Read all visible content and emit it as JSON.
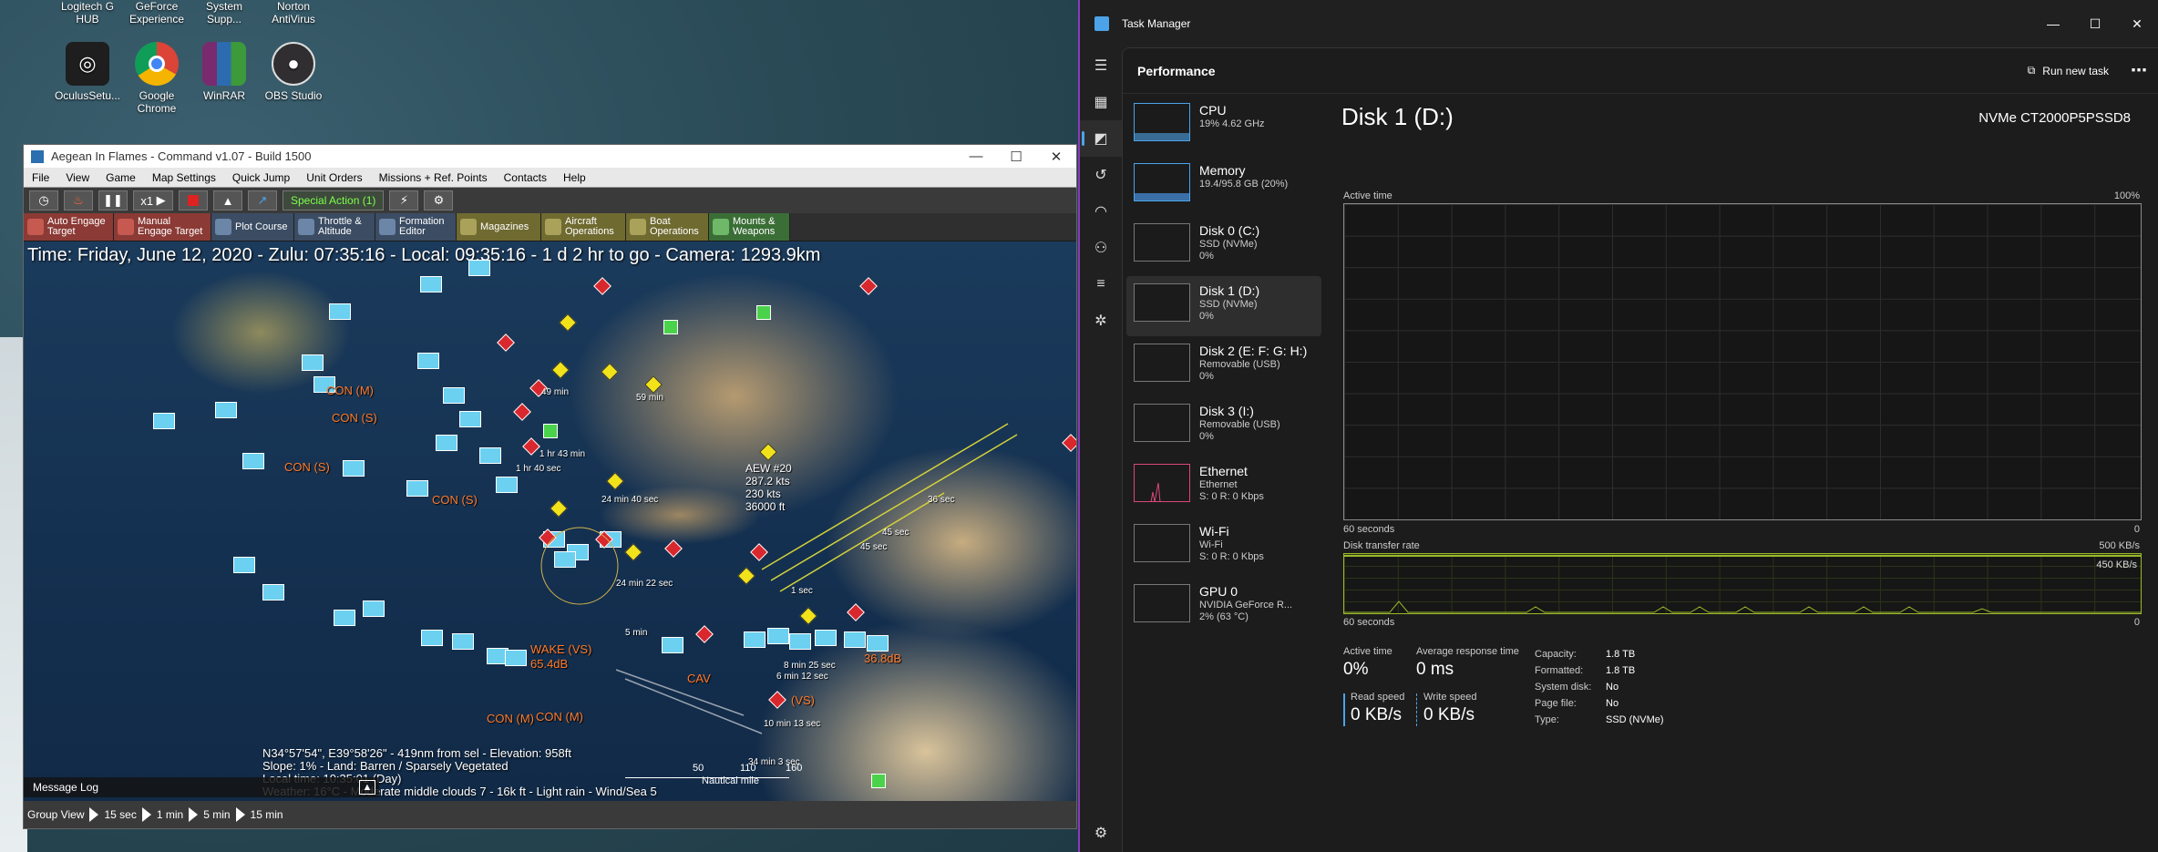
{
  "desktop": {
    "top_icons": [
      "Logitech G HUB",
      "GeForce Experience",
      "System Supp...",
      "Norton AntiVirus"
    ],
    "icons": [
      {
        "label": "OculusSetu...",
        "icon": "oculus-icon",
        "color": "#222222"
      },
      {
        "label": "Google Chrome",
        "icon": "chrome-icon",
        "color": "#db4437"
      },
      {
        "label": "WinRAR",
        "icon": "winrar-icon",
        "color": "#7a2a6e"
      },
      {
        "label": "OBS Studio",
        "icon": "obs-icon",
        "color": "#302e31"
      }
    ]
  },
  "game": {
    "title": "Aegean In Flames - Command v1.07 - Build 1500",
    "menu": [
      "File",
      "View",
      "Game",
      "Map Settings",
      "Quick Jump",
      "Unit Orders",
      "Missions + Ref. Points",
      "Contacts",
      "Help"
    ],
    "speed": "x1",
    "special_action": "Special Action (1)",
    "toolbar2": [
      {
        "label": "Auto Engage Target",
        "style": "red"
      },
      {
        "label": "Manual Engage Target",
        "style": "red"
      },
      {
        "label": "Plot Course",
        "style": "blue"
      },
      {
        "label": "Throttle & Altitude",
        "style": "blue"
      },
      {
        "label": "Formation Editor",
        "style": "blue"
      },
      {
        "label": "Magazines",
        "style": "gold"
      },
      {
        "label": "Aircraft Operations",
        "style": "gold"
      },
      {
        "label": "Boat Operations",
        "style": "gold"
      },
      {
        "label": "Mounts & Weapons",
        "style": "green"
      }
    ],
    "map_time": "Time: Friday, June 12, 2020 - Zulu: 07:35:16 - Local: 09:35:16 - 1 d 2 hr to go - Camera: 1293.9km",
    "map_labels": [
      {
        "text": "CON (M)",
        "color": "orange"
      },
      {
        "text": "CON (S)",
        "color": "orange"
      },
      {
        "text": "CON (S)",
        "color": "orange"
      },
      {
        "text": "CON (S)",
        "color": "orange"
      },
      {
        "text": "WAKE (VS)",
        "color": "orange"
      },
      {
        "text": "65.4dB",
        "color": "orange"
      },
      {
        "text": "CON (M)",
        "color": "orange"
      },
      {
        "text": "CON (M)",
        "color": "orange"
      },
      {
        "text": "CAV",
        "color": "orange"
      },
      {
        "text": "36.8dB",
        "color": "orange"
      },
      {
        "text": "(VS)",
        "color": "orange"
      }
    ],
    "map_times": [
      "49 min",
      "59 min",
      "1 hr 43 min",
      "1 hr 40 sec",
      "24 min 40 sec",
      "24 min 22 sec",
      "1 sec",
      "45 sec",
      "45 sec",
      "36 sec",
      "5 min",
      "8 min 25 sec",
      "6 min 12 sec",
      "10 min 13 sec",
      "34 min 3 sec"
    ],
    "track_info": [
      "AEW #20",
      "287.2 kts",
      "230 kts",
      "36000 ft"
    ],
    "info": [
      "N34°57'54\", E39°58'26\" - 419nm from sel - Elevation: 958ft",
      "Slope: 1% - Land: Barren / Sparsely Vegetated",
      "Local time: 10:35:01 (Day)",
      "Weather: 16°C - Moderate middle clouds 7 - 16k ft - Light rain - Wind/Sea 5"
    ],
    "scale": [
      "50",
      "110",
      "160",
      "Nautical mile"
    ],
    "message_log": "Message Log",
    "status": [
      "Group View",
      "15 sec",
      "1 min",
      "5 min",
      "15 min"
    ]
  },
  "taskmanager": {
    "title": "Task Manager",
    "section": "Performance",
    "run_new_task": "Run new task",
    "devices": [
      {
        "name": "CPU",
        "l1": "19% 4.62 GHz",
        "l2": "",
        "l3": "",
        "color": "#4ca3e8",
        "level": 0.19
      },
      {
        "name": "Memory",
        "l1": "19.4/95.8 GB (20%)",
        "l2": "",
        "l3": "",
        "color": "#4ca3e8",
        "level": 0.2
      },
      {
        "name": "Disk 0 (C:)",
        "l1": "SSD (NVMe)",
        "l2": "0%",
        "l3": "",
        "color": "#9bb82a",
        "level": 0
      },
      {
        "name": "Disk 1 (D:)",
        "l1": "SSD (NVMe)",
        "l2": "0%",
        "l3": "",
        "color": "#9bb82a",
        "level": 0
      },
      {
        "name": "Disk 2 (E: F: G: H:)",
        "l1": "Removable (USB)",
        "l2": "0%",
        "l3": "",
        "color": "#9bb82a",
        "level": 0
      },
      {
        "name": "Disk 3 (I:)",
        "l1": "Removable (USB)",
        "l2": "0%",
        "l3": "",
        "color": "#9bb82a",
        "level": 0
      },
      {
        "name": "Ethernet",
        "l1": "Ethernet",
        "l2": "S: 0 R: 0 Kbps",
        "l3": "",
        "color": "#d9487a",
        "level": 0.35
      },
      {
        "name": "Wi-Fi",
        "l1": "Wi-Fi",
        "l2": "S: 0 R: 0 Kbps",
        "l3": "",
        "color": "#d9487a",
        "level": 0
      },
      {
        "name": "GPU 0",
        "l1": "NVIDIA GeForce R...",
        "l2": "2% (63 °C)",
        "l3": "",
        "color": "#4ca3e8",
        "level": 0.02
      }
    ],
    "detail": {
      "title": "Disk 1 (D:)",
      "model": "NVMe CT2000P5PSSD8",
      "active_time_label": "Active time",
      "active_time_max": "100%",
      "seconds_label": "60 seconds",
      "zero": "0",
      "transfer_label": "Disk transfer rate",
      "transfer_max": "500 KB/s",
      "transfer_line": "450 KB/s",
      "stats": {
        "active_time": {
          "label": "Active time",
          "value": "0%"
        },
        "avg_response": {
          "label": "Average response time",
          "value": "0 ms"
        },
        "read_speed": {
          "label": "Read speed",
          "value": "0 KB/s"
        },
        "write_speed": {
          "label": "Write speed",
          "value": "0 KB/s"
        }
      },
      "props": [
        {
          "k": "Capacity:",
          "v": "1.8 TB"
        },
        {
          "k": "Formatted:",
          "v": "1.8 TB"
        },
        {
          "k": "System disk:",
          "v": "No"
        },
        {
          "k": "Page file:",
          "v": "No"
        },
        {
          "k": "Type:",
          "v": "SSD (NVMe)"
        }
      ]
    }
  }
}
